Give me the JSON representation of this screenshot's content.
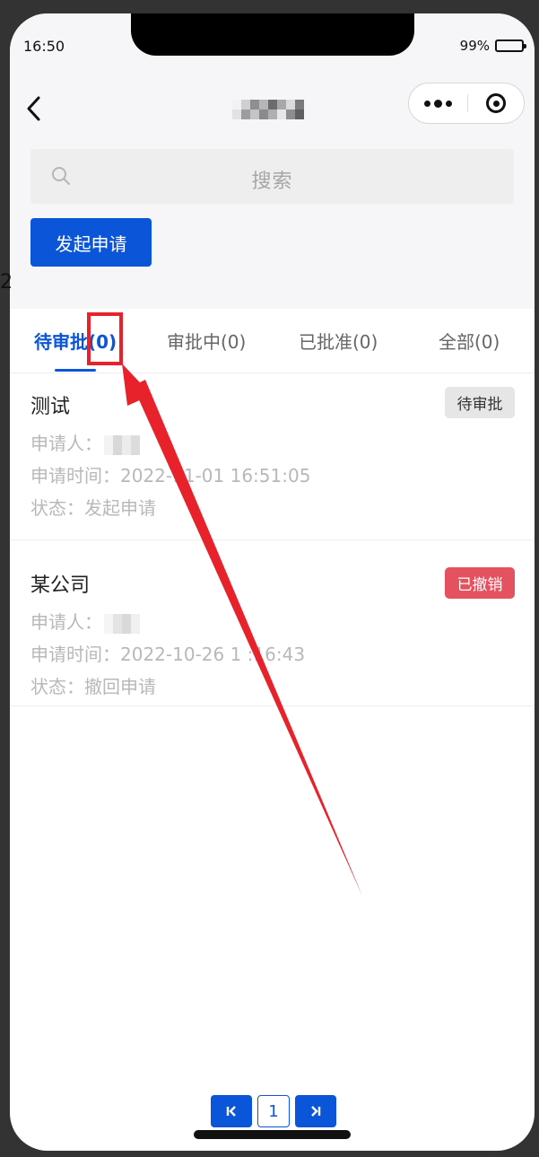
{
  "status_bar": {
    "time": "16:50",
    "battery": "99%"
  },
  "nav": {
    "title_obscured": true
  },
  "search": {
    "placeholder": "搜索"
  },
  "actions": {
    "apply_label": "发起申请"
  },
  "stray_text": "2",
  "tabs": [
    {
      "label": "待审批(0)",
      "active": true
    },
    {
      "label": "审批中(0)",
      "active": false
    },
    {
      "label": "已批准(0)",
      "active": false
    },
    {
      "label": "全部(0)",
      "active": false
    }
  ],
  "records": [
    {
      "title": "测试",
      "badge": "待审批",
      "applicant_label": "申请人：",
      "time_label": "申请时间：",
      "time_value": "2022-11-01 16:51:05",
      "status_label": "状态：",
      "status_value": "发起申请"
    },
    {
      "title": "某公司",
      "badge": "已撤销",
      "applicant_label": "申请人：",
      "time_label": "申请时间：",
      "time_value": "2022-10-26 1 :16:43",
      "status_label": "状态：",
      "status_value": "撤回申请"
    }
  ],
  "pagination": {
    "current_page": "1"
  },
  "colors": {
    "primary": "#0b56d8",
    "danger_badge": "#e4515f",
    "annotation_red": "#e8222b",
    "muted_text": "#b8b8b8"
  }
}
